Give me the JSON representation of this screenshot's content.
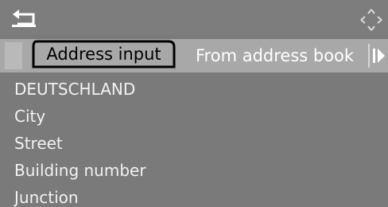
{
  "header": {
    "back_icon": "back-arrow-icon",
    "nav_icon": "navigation-diamond-icon"
  },
  "tabs": {
    "active_label": "Address input",
    "inactive_label": "From address book",
    "next_icon": "next-tab-arrow-icon"
  },
  "list": {
    "items": [
      {
        "label": "DEUTSCHLAND"
      },
      {
        "label": "City"
      },
      {
        "label": "Street"
      },
      {
        "label": "Building number"
      },
      {
        "label": "Junction"
      }
    ]
  },
  "colors": {
    "screen_background": "#7a7a7a",
    "tabbar_background": "#a8a8a8",
    "text": "#f2f2f2"
  }
}
